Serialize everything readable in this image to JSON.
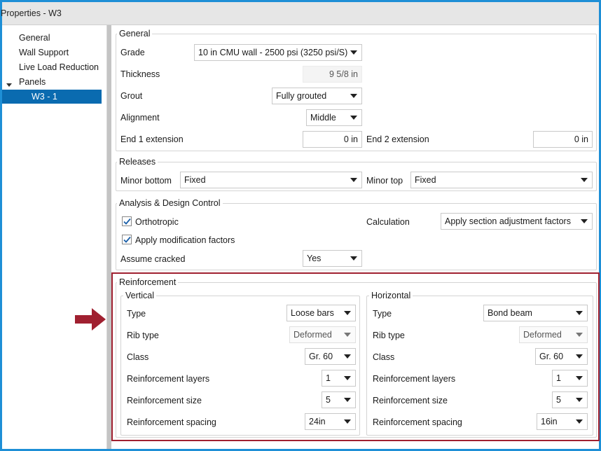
{
  "window": {
    "title": "Properties - W3"
  },
  "sidebar": {
    "items": [
      {
        "label": "General"
      },
      {
        "label": "Wall Support"
      },
      {
        "label": "Live Load Reduction"
      },
      {
        "label": "Panels"
      },
      {
        "label": "W3 - 1"
      }
    ]
  },
  "general": {
    "title": "General",
    "grade_label": "Grade",
    "grade_value": "10 in CMU wall - 2500 psi (3250 psi/S)",
    "thickness_label": "Thickness",
    "thickness_value": "9 5/8 in",
    "grout_label": "Grout",
    "grout_value": "Fully grouted",
    "alignment_label": "Alignment",
    "alignment_value": "Middle",
    "end1_label": "End 1 extension",
    "end1_value": "0 in",
    "end2_label": "End 2 extension",
    "end2_value": "0 in"
  },
  "releases": {
    "title": "Releases",
    "minor_bottom_label": "Minor bottom",
    "minor_bottom_value": "Fixed",
    "minor_top_label": "Minor top",
    "minor_top_value": "Fixed"
  },
  "analysis": {
    "title": "Analysis & Design Control",
    "orthotropic_label": "Orthotropic",
    "orthotropic_checked": true,
    "apply_mod_label": "Apply modification factors",
    "apply_mod_checked": true,
    "calculation_label": "Calculation",
    "calculation_value": "Apply section adjustment factors",
    "assume_cracked_label": "Assume cracked",
    "assume_cracked_value": "Yes"
  },
  "reinforcement": {
    "title": "Reinforcement",
    "vertical": {
      "title": "Vertical",
      "type_label": "Type",
      "type_value": "Loose bars",
      "rib_label": "Rib type",
      "rib_value": "Deformed",
      "class_label": "Class",
      "class_value": "Gr. 60",
      "layers_label": "Reinforcement layers",
      "layers_value": "1",
      "size_label": "Reinforcement size",
      "size_value": "5",
      "spacing_label": "Reinforcement spacing",
      "spacing_value": "24in"
    },
    "horizontal": {
      "title": "Horizontal",
      "type_label": "Type",
      "type_value": "Bond beam",
      "rib_label": "Rib type",
      "rib_value": "Deformed",
      "class_label": "Class",
      "class_value": "Gr. 60",
      "layers_label": "Reinforcement layers",
      "layers_value": "1",
      "size_label": "Reinforcement size",
      "size_value": "5",
      "spacing_label": "Reinforcement spacing",
      "spacing_value": "16in"
    }
  },
  "colors": {
    "window_border": "#1e8fd6",
    "selection": "#0a6bb0",
    "annotation": "#a02030"
  }
}
